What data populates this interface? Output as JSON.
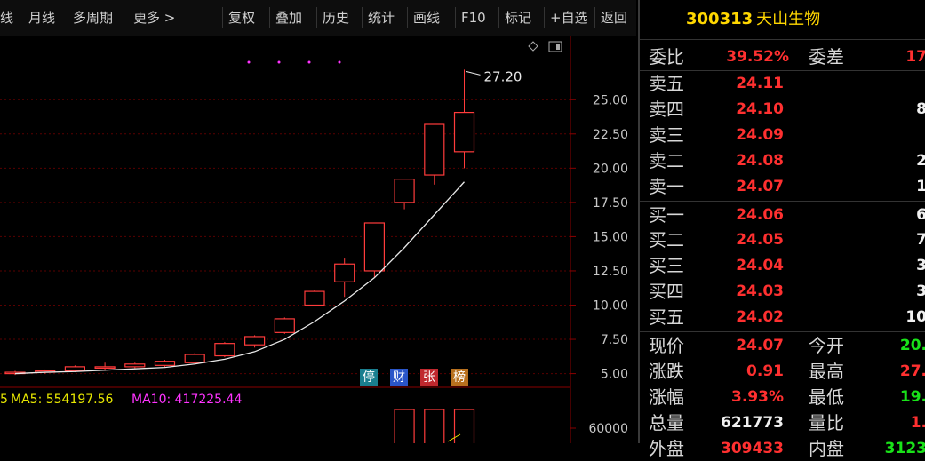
{
  "toolbar": {
    "items": [
      "线",
      "月线",
      "多周期",
      "更多 >",
      "复权",
      "叠加",
      "历史",
      "统计",
      "画线",
      "F10",
      "标记",
      "+自选",
      "返回"
    ]
  },
  "chart": {
    "max_label": "27.20",
    "price_axis": [
      "25.00",
      "22.50",
      "20.00",
      "17.50",
      "15.00",
      "12.50",
      "10.00",
      "7.50",
      "5.00"
    ],
    "vol_axis": [
      "60000"
    ],
    "ma_label_prefix": "5",
    "ma5_label": "MA5: 554197.56",
    "ma10_label": "MA10: 417225.44",
    "badges": [
      {
        "text": "停",
        "color": "#1a7f8f"
      },
      {
        "text": "财",
        "color": "#2a55c8"
      },
      {
        "text": "张",
        "color": "#c0282e"
      },
      {
        "text": "榜",
        "color": "#b8701e"
      }
    ],
    "colors": {
      "up": "#ff3b3b",
      "down": "#18c7d6",
      "ma": "#e8e8e8",
      "ma10": "#ff33ff",
      "ma5": "#e8e800"
    }
  },
  "chart_data": {
    "type": "candlestick",
    "ylim": [
      4.0,
      28.0
    ],
    "candles": [
      {
        "o": 5.0,
        "h": 5.2,
        "l": 4.9,
        "c": 5.1
      },
      {
        "o": 5.1,
        "h": 5.3,
        "l": 5.0,
        "c": 5.2
      },
      {
        "o": 5.2,
        "h": 5.6,
        "l": 5.1,
        "c": 5.5
      },
      {
        "o": 5.4,
        "h": 5.8,
        "l": 5.2,
        "c": 5.5
      },
      {
        "o": 5.5,
        "h": 5.8,
        "l": 5.4,
        "c": 5.7
      },
      {
        "o": 5.6,
        "h": 6.0,
        "l": 5.5,
        "c": 5.9
      },
      {
        "o": 5.8,
        "h": 6.5,
        "l": 5.7,
        "c": 6.4
      },
      {
        "o": 6.3,
        "h": 7.3,
        "l": 6.2,
        "c": 7.2
      },
      {
        "o": 7.1,
        "h": 7.8,
        "l": 6.9,
        "c": 7.7
      },
      {
        "o": 8.0,
        "h": 9.1,
        "l": 7.9,
        "c": 9.0
      },
      {
        "o": 10.0,
        "h": 11.1,
        "l": 9.9,
        "c": 11.0
      },
      {
        "o": 11.7,
        "h": 13.4,
        "l": 10.6,
        "c": 13.0
      },
      {
        "o": 12.5,
        "h": 16.0,
        "l": 12.0,
        "c": 16.0
      },
      {
        "o": 17.5,
        "h": 19.2,
        "l": 17.0,
        "c": 19.2
      },
      {
        "o": 19.5,
        "h": 23.2,
        "l": 18.8,
        "c": 23.2
      },
      {
        "o": 21.2,
        "h": 27.2,
        "l": 20.0,
        "c": 24.07
      }
    ],
    "ma": [
      5.0,
      5.1,
      5.15,
      5.25,
      5.35,
      5.45,
      5.7,
      6.05,
      6.6,
      7.5,
      8.8,
      10.3,
      12.0,
      14.2,
      16.6,
      19.0
    ],
    "volume": [
      {
        "index": 13,
        "v": 63000
      },
      {
        "index": 14,
        "v": 71000
      },
      {
        "index": 15,
        "v": 67000
      }
    ],
    "vol_range": [
      0,
      80000
    ]
  },
  "quote": {
    "code": "300313",
    "name": "天山生物",
    "weibi_label": "委比",
    "weibi": "39.52%",
    "weicha_label": "委差",
    "weicha": "17",
    "asks": [
      {
        "label": "卖五",
        "price": "24.11",
        "vol": ""
      },
      {
        "label": "卖四",
        "price": "24.10",
        "vol": "8"
      },
      {
        "label": "卖三",
        "price": "24.09",
        "vol": ""
      },
      {
        "label": "卖二",
        "price": "24.08",
        "vol": "2"
      },
      {
        "label": "卖一",
        "price": "24.07",
        "vol": "1"
      }
    ],
    "bids": [
      {
        "label": "买一",
        "price": "24.06",
        "vol": "6"
      },
      {
        "label": "买二",
        "price": "24.05",
        "vol": "7"
      },
      {
        "label": "买三",
        "price": "24.04",
        "vol": "3"
      },
      {
        "label": "买四",
        "price": "24.03",
        "vol": "3"
      },
      {
        "label": "买五",
        "price": "24.02",
        "vol": "10"
      }
    ],
    "stats": [
      {
        "l1": "现价",
        "v1": "24.07",
        "c1": "red",
        "l2": "今开",
        "v2": "20.",
        "c2": "green"
      },
      {
        "l1": "涨跌",
        "v1": "0.91",
        "c1": "red",
        "l2": "最高",
        "v2": "27.",
        "c2": "red"
      },
      {
        "l1": "涨幅",
        "v1": "3.93%",
        "c1": "red",
        "l2": "最低",
        "v2": "19.",
        "c2": "green"
      },
      {
        "l1": "总量",
        "v1": "621773",
        "c1": "wht",
        "l2": "量比",
        "v2": "1.",
        "c2": "red"
      },
      {
        "l1": "外盘",
        "v1": "309433",
        "c1": "red",
        "l2": "内盘",
        "v2": "3123",
        "c2": "green"
      }
    ]
  }
}
